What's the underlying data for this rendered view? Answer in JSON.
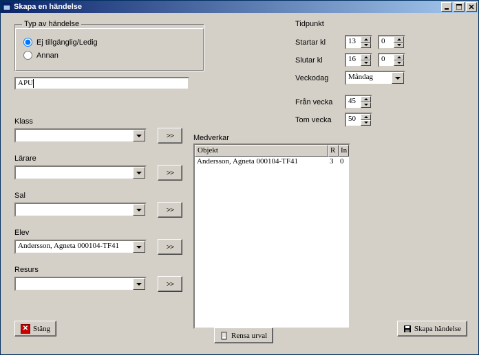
{
  "window": {
    "title": "Skapa en händelse"
  },
  "event_type": {
    "legend": "Typ av händelse",
    "option1": "Ej tillgänglig/Ledig",
    "option2": "Annan"
  },
  "apu_value": "APU",
  "selectors": {
    "klass": {
      "label": "Klass",
      "value": ""
    },
    "larare": {
      "label": "Lärare",
      "value": ""
    },
    "sal": {
      "label": "Sal",
      "value": ""
    },
    "elev": {
      "label": "Elev",
      "value": "Andersson, Agneta 000104-TF41"
    },
    "resurs": {
      "label": "Resurs",
      "value": ""
    }
  },
  "add_symbol": ">>",
  "tidpunkt": {
    "heading": "Tidpunkt",
    "start_label": "Startar kl",
    "start_h": "13",
    "start_m": "0",
    "end_label": "Slutar kl",
    "end_h": "16",
    "end_m": "0",
    "weekday_label": "Veckodag",
    "weekday_value": "Måndag",
    "from_week_label": "Från vecka",
    "from_week_value": "45",
    "to_week_label": "Tom vecka",
    "to_week_value": "50"
  },
  "medverkar": {
    "label": "Medverkar",
    "columns": {
      "objekt": "Objekt",
      "r": "R",
      "in": "In"
    },
    "rows": [
      {
        "objekt": "Andersson, Agneta 000104-TF41",
        "r": "3",
        "in": "0"
      }
    ]
  },
  "buttons": {
    "close": "Stäng",
    "clear": "Rensa urval",
    "create": "Skapa händelse"
  }
}
